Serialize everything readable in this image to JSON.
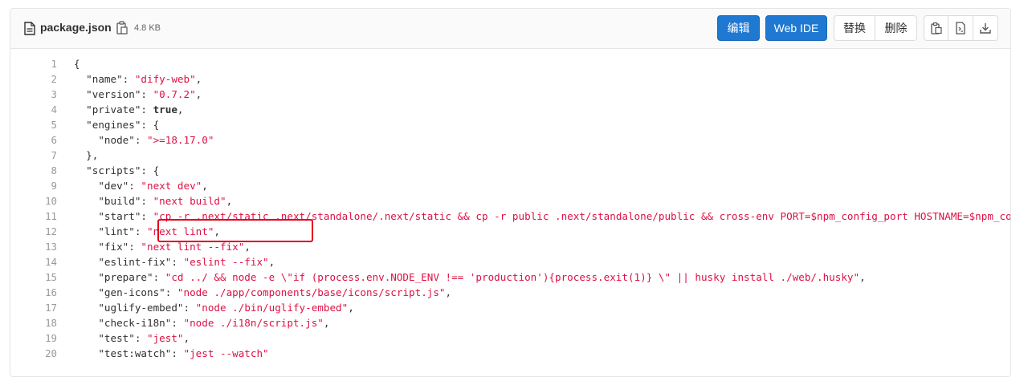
{
  "file": {
    "name": "package.json",
    "size": "4.8 KB",
    "icon": "file-icon"
  },
  "toolbar": {
    "edit_label": "编辑",
    "webide_label": "Web IDE",
    "replace_label": "替换",
    "delete_label": "删除",
    "copy_icon": "copy-icon",
    "raw_icon": "raw-file-icon",
    "download_icon": "download-icon"
  },
  "colors": {
    "primary": "#1f78d1",
    "string": "#dd1144",
    "line_number": "#999999",
    "highlight": "#e2001a"
  },
  "code_lines": [
    {
      "n": "1",
      "html": "{"
    },
    {
      "n": "2",
      "html": "  \"name\": <span class=\"s\">\"dify-web\"</span>,"
    },
    {
      "n": "3",
      "html": "  \"version\": <span class=\"s\">\"0.7.2\"</span>,"
    },
    {
      "n": "4",
      "html": "  \"private\": <span class=\"b\">true</span>,"
    },
    {
      "n": "5",
      "html": "  \"engines\": {"
    },
    {
      "n": "6",
      "html": "    \"node\": <span class=\"s\">\"&gt;=18.17.0\"</span>"
    },
    {
      "n": "7",
      "html": "  },"
    },
    {
      "n": "8",
      "html": "  \"scripts\": {"
    },
    {
      "n": "9",
      "html": "    \"dev\": <span class=\"s\">\"next dev\"</span>,"
    },
    {
      "n": "10",
      "html": "    \"build\": <span class=\"s\">\"next build\"</span>,"
    },
    {
      "n": "11",
      "html": "    \"start\": <span class=\"s\">\"cp -r .next/static .next/standalone/.next/static &amp;&amp; cp -r public .next/standalone/public &amp;&amp; cross-env PORT=$npm_config_port HOSTNAME=$npm_config_host node .next/standalone/server.js\"</span>,"
    },
    {
      "n": "12",
      "html": "    \"lint\": <span class=\"s\">\"next lint\"</span>,"
    },
    {
      "n": "13",
      "html": "    \"fix\": <span class=\"s\">\"next lint --fix\"</span>,"
    },
    {
      "n": "14",
      "html": "    \"eslint-fix\": <span class=\"s\">\"eslint --fix\"</span>,"
    },
    {
      "n": "15",
      "html": "    \"prepare\": <span class=\"s\">\"cd ../ &amp;&amp; node -e \\\"if (process.env.NODE_ENV !== 'production'){process.exit(1)} \\\" || husky install ./web/.husky\"</span>,"
    },
    {
      "n": "16",
      "html": "    \"gen-icons\": <span class=\"s\">\"node ./app/components/base/icons/script.js\"</span>,"
    },
    {
      "n": "17",
      "html": "    \"uglify-embed\": <span class=\"s\">\"node ./bin/uglify-embed\"</span>,"
    },
    {
      "n": "18",
      "html": "    \"check-i18n\": <span class=\"s\">\"node ./i18n/script.js\"</span>,"
    },
    {
      "n": "19",
      "html": "    \"test\": <span class=\"s\">\"jest\"</span>,"
    },
    {
      "n": "20",
      "html": "    \"test:watch\": <span class=\"s\">\"jest --watch\"</span>"
    }
  ]
}
